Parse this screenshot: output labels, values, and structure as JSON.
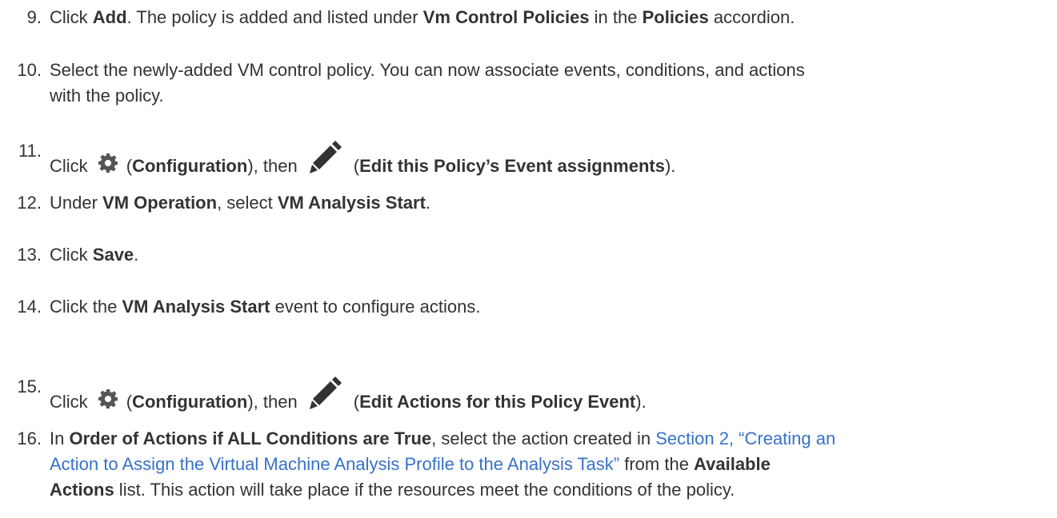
{
  "steps": [
    {
      "number": "9.",
      "parts": {
        "p1": "Click ",
        "b1": "Add",
        "p2": ". The policy is added and listed under ",
        "b2": "Vm Control Policies",
        "p3": " in the ",
        "b3": "Policies",
        "p4": " accordion."
      }
    },
    {
      "number": "10.",
      "parts": {
        "line1": "Select the newly-added VM control policy. You can now associate events, conditions, and actions",
        "line2": "with the policy."
      }
    },
    {
      "number": "11.",
      "parts": {
        "p1": "Click ",
        "p2": "(",
        "b1": "Configuration",
        "p3": "), then ",
        "p4": "(",
        "b2": "Edit this Policy’s Event assignments",
        "p5": ")."
      }
    },
    {
      "number": "12.",
      "parts": {
        "p1": "Under ",
        "b1": "VM Operation",
        "p2": ", select ",
        "b2": "VM Analysis Start",
        "p3": "."
      }
    },
    {
      "number": "13.",
      "parts": {
        "p1": "Click ",
        "b1": "Save",
        "p2": "."
      }
    },
    {
      "number": "14.",
      "parts": {
        "p1": "Click the ",
        "b1": "VM Analysis Start",
        "p2": " event to configure actions."
      }
    },
    {
      "number": "15.",
      "parts": {
        "p1": "Click ",
        "p2": "(",
        "b1": "Configuration",
        "p3": "), then ",
        "p4": "(",
        "b2": "Edit Actions for this Policy Event",
        "p5": ")."
      }
    },
    {
      "number": "16.",
      "parts": {
        "p1": "In ",
        "b1": "Order of Actions if ALL Conditions are True",
        "p2": ", select the action created in ",
        "link1": "Section 2, “Creating an",
        "link2": "Action to Assign the Virtual Machine Analysis Profile to the Analysis Task”",
        "p3": " from the ",
        "b2": "Available",
        "b3": "Actions",
        "p4": " list. This action will take place if the resources meet the conditions of the policy."
      }
    }
  ],
  "icons": {
    "configuration": "gear-icon",
    "edit": "pencil-icon"
  },
  "colors": {
    "text": "#333333",
    "link": "#3771c8",
    "icon": "#555555"
  }
}
